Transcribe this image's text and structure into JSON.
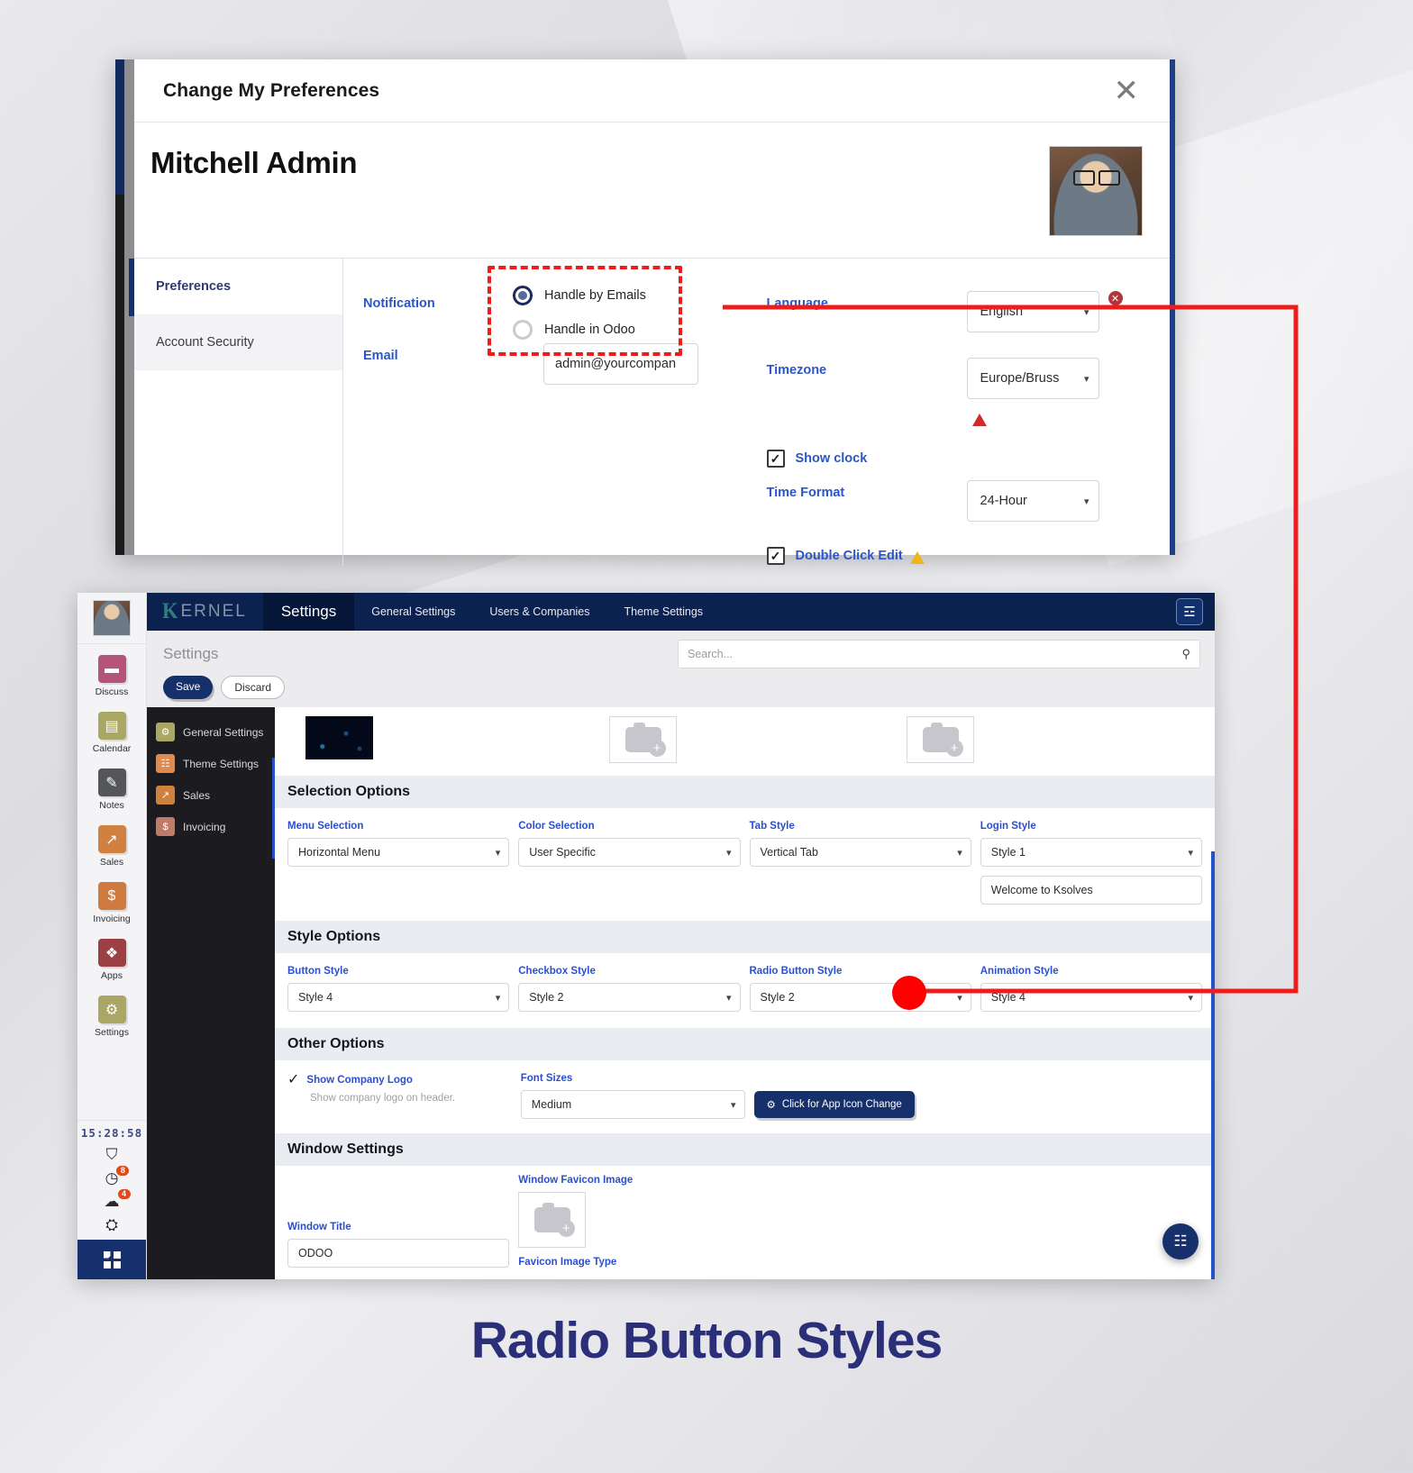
{
  "caption": "Radio Button Styles",
  "preferences_dialog": {
    "title": "Change My Preferences",
    "close_label": "✕",
    "user_name": "Mitchell Admin",
    "avatar_name": "user-avatar",
    "tabs": [
      {
        "label": "Preferences",
        "active": true
      },
      {
        "label": "Account Security",
        "active": false
      }
    ],
    "fields": {
      "notification_label": "Notification",
      "radio_options": [
        {
          "label": "Handle by Emails",
          "selected": true
        },
        {
          "label": "Handle in Odoo",
          "selected": false
        }
      ],
      "email_label": "Email",
      "email_value": "admin@yourcompan",
      "language_label": "Language",
      "language_value": "English",
      "language_badge": "✕",
      "timezone_label": "Timezone",
      "timezone_value": "Europe/Bruss",
      "show_clock_label": "Show clock",
      "show_clock_checked": "✓",
      "time_format_label": "Time Format",
      "time_format_value": "24-Hour",
      "double_click_label": "Double Click Edit",
      "double_click_checked": "✓"
    }
  },
  "odoo_window": {
    "sidebar": {
      "apps": [
        {
          "label": "Discuss",
          "icon": "chat-icon",
          "glyph": "▬",
          "color": "#b4547a"
        },
        {
          "label": "Calendar",
          "icon": "calendar-icon",
          "glyph": "▤",
          "color": "#aaa765"
        },
        {
          "label": "Notes",
          "icon": "notes-icon",
          "glyph": "✎",
          "color": "#55565a"
        },
        {
          "label": "Sales",
          "icon": "chart-icon",
          "glyph": "↗",
          "color": "#d0803f"
        },
        {
          "label": "Invoicing",
          "icon": "invoice-icon",
          "glyph": "$",
          "color": "#d07a40"
        },
        {
          "label": "Apps",
          "icon": "apps-icon",
          "glyph": "❖",
          "color": "#9c4044"
        },
        {
          "label": "Settings",
          "icon": "gear-icon",
          "glyph": "⚙",
          "color": "#aaa765"
        }
      ],
      "clock": "15:28:58",
      "tray": [
        {
          "icon": "activity-icon",
          "glyph": "⛉",
          "badge": ""
        },
        {
          "icon": "clock-icon",
          "glyph": "◷",
          "badge": "8"
        },
        {
          "icon": "message-icon",
          "glyph": "☁",
          "badge": "4"
        },
        {
          "icon": "company-icon",
          "glyph": "⛭",
          "badge": ""
        }
      ]
    },
    "navbar": {
      "brand_k": "K",
      "brand_text": "ERNEL",
      "active": "Settings",
      "items": [
        "General Settings",
        "Users & Companies",
        "Theme Settings"
      ],
      "sliders_icon": "☲"
    },
    "control": {
      "breadcrumb": "Settings",
      "search_placeholder": "Search...",
      "search_icon": "⚲",
      "save_label": "Save",
      "discard_label": "Discard"
    },
    "settings_menu": [
      {
        "label": "General Settings",
        "icon": "gear-icon",
        "glyph": "⚙",
        "color": "#aaa765"
      },
      {
        "label": "Theme Settings",
        "icon": "theme-icon",
        "glyph": "☷",
        "color": "#e08a4e"
      },
      {
        "label": "Sales",
        "icon": "chart-icon",
        "glyph": "↗",
        "color": "#d0803f"
      },
      {
        "label": "Invoicing",
        "icon": "invoice-icon",
        "glyph": "$",
        "color": "#c07a68"
      }
    ],
    "sections": {
      "selection": {
        "header": "Selection Options",
        "fields": [
          {
            "label": "Menu Selection",
            "value": "Horizontal Menu"
          },
          {
            "label": "Color Selection",
            "value": "User Specific"
          },
          {
            "label": "Tab Style",
            "value": "Vertical Tab"
          },
          {
            "label": "Login Style",
            "value": "Style 1",
            "extra_value": "Welcome to Ksolves"
          }
        ]
      },
      "style": {
        "header": "Style Options",
        "fields": [
          {
            "label": "Button Style",
            "value": "Style 4"
          },
          {
            "label": "Checkbox Style",
            "value": "Style 2"
          },
          {
            "label": "Radio Button Style",
            "value": "Style 2"
          },
          {
            "label": "Animation Style",
            "value": "Style 4"
          }
        ]
      },
      "other": {
        "header": "Other Options",
        "show_logo_label": "Show Company Logo",
        "show_logo_check": "✓",
        "show_logo_sub": "Show company logo on header.",
        "font_sizes_label": "Font Sizes",
        "font_sizes_value": "Medium",
        "app_icon_button": "Click for App Icon Change",
        "app_icon_glyph": "⚙"
      },
      "window": {
        "header": "Window Settings",
        "window_title_label": "Window Title",
        "window_title_value": "ODOO",
        "favicon_label": "Window Favicon Image",
        "favicon_type_label": "Favicon Image Type"
      }
    },
    "fab_icon": "☷"
  },
  "colors": {
    "navy": "#0b2150",
    "accent_blue": "#2b4fd0",
    "annotation_red": "#ef1c1c"
  }
}
